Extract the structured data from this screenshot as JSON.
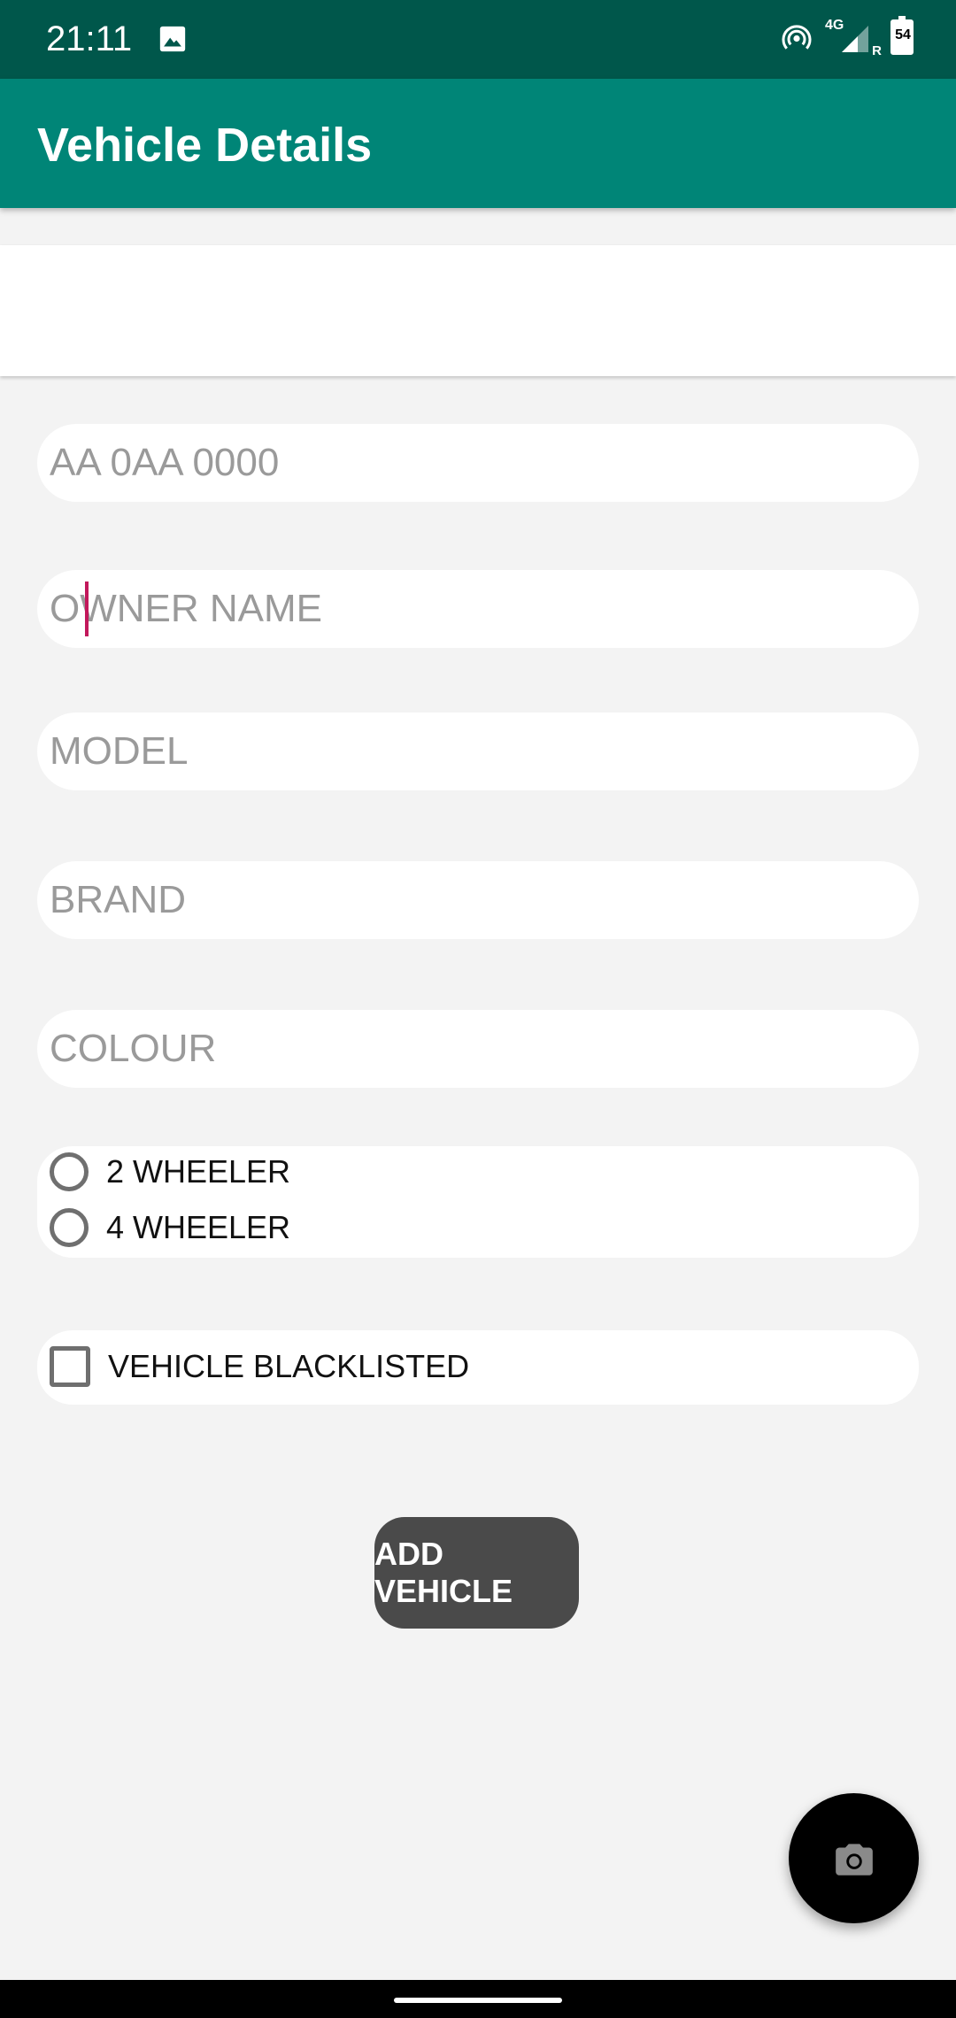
{
  "status_bar": {
    "time": "21:11",
    "icons": [
      "gallery-icon",
      "hotspot-icon",
      "network-4g-icon",
      "signal-icon",
      "battery-icon"
    ],
    "network_label": "4G",
    "roaming_label": "R",
    "battery_level": "54"
  },
  "app_bar": {
    "title": "Vehicle Details"
  },
  "form": {
    "registration_placeholder": "AA 0AA 0000",
    "owner_placeholder": "OWNER NAME",
    "model_placeholder": "MODEL",
    "brand_placeholder": "BRAND",
    "colour_placeholder": "COLOUR",
    "wheel_options": [
      "2 WHEELER",
      "4 WHEELER"
    ],
    "blacklisted_label": "VEHICLE BLACKLISTED",
    "blacklisted_checked": false,
    "add_button_label": "ADD VEHICLE"
  },
  "fab": {
    "icon": "camera-icon"
  },
  "colors": {
    "status_bar": "#00574b",
    "app_bar": "#008577",
    "background": "#f3f3f3",
    "button": "#4a4a4a",
    "cursor": "#c2185b",
    "fab": "#000000"
  }
}
